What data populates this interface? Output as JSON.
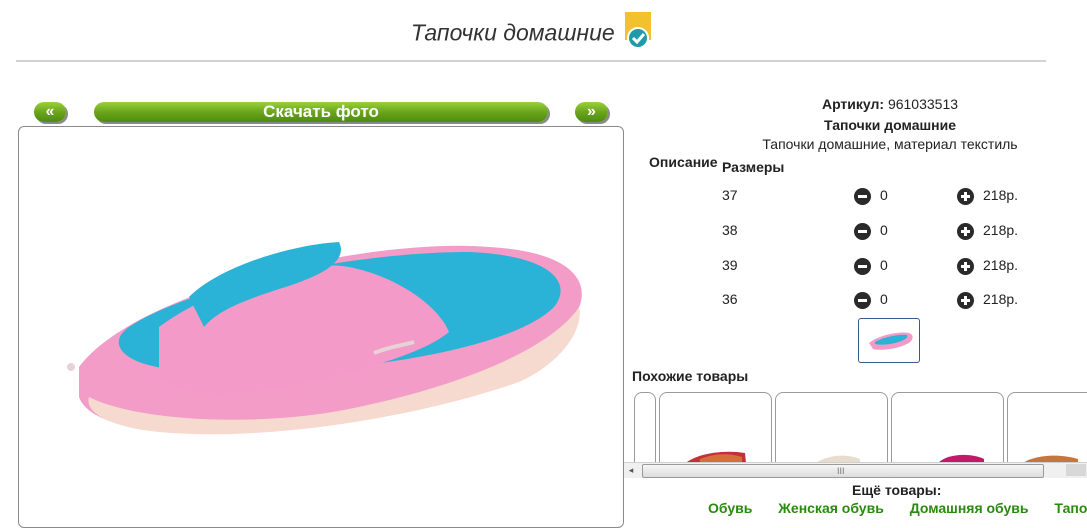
{
  "page": {
    "title": "Тапочки домашние",
    "badge_icon": "checkmark-badge-icon"
  },
  "gallery": {
    "prev_label": "«",
    "download_label": "Скачать фото",
    "next_label": "»"
  },
  "product": {
    "article_label": "Артикул:",
    "article_value": "961033513",
    "name": "Тапочки домашние",
    "description_text": "Тапочки домашние, материал текстиль",
    "description_label": "Описание",
    "sizes_label": "Размеры"
  },
  "sizes": [
    {
      "size": "37",
      "qty": "0",
      "price": "218р."
    },
    {
      "size": "38",
      "qty": "0",
      "price": "218р."
    },
    {
      "size": "39",
      "qty": "0",
      "price": "218р."
    },
    {
      "size": "36",
      "qty": "0",
      "price": "218р."
    }
  ],
  "similar": {
    "title": "Похожие товары"
  },
  "more": {
    "title": "Ещё товары:",
    "links": [
      "Обувь",
      "Женская обувь",
      "Домашняя обувь",
      "Тапочки"
    ]
  },
  "colors": {
    "accent_green": "#6aa51c",
    "slipper_pink": "#f49ac8",
    "slipper_blue": "#2ab3d6"
  }
}
